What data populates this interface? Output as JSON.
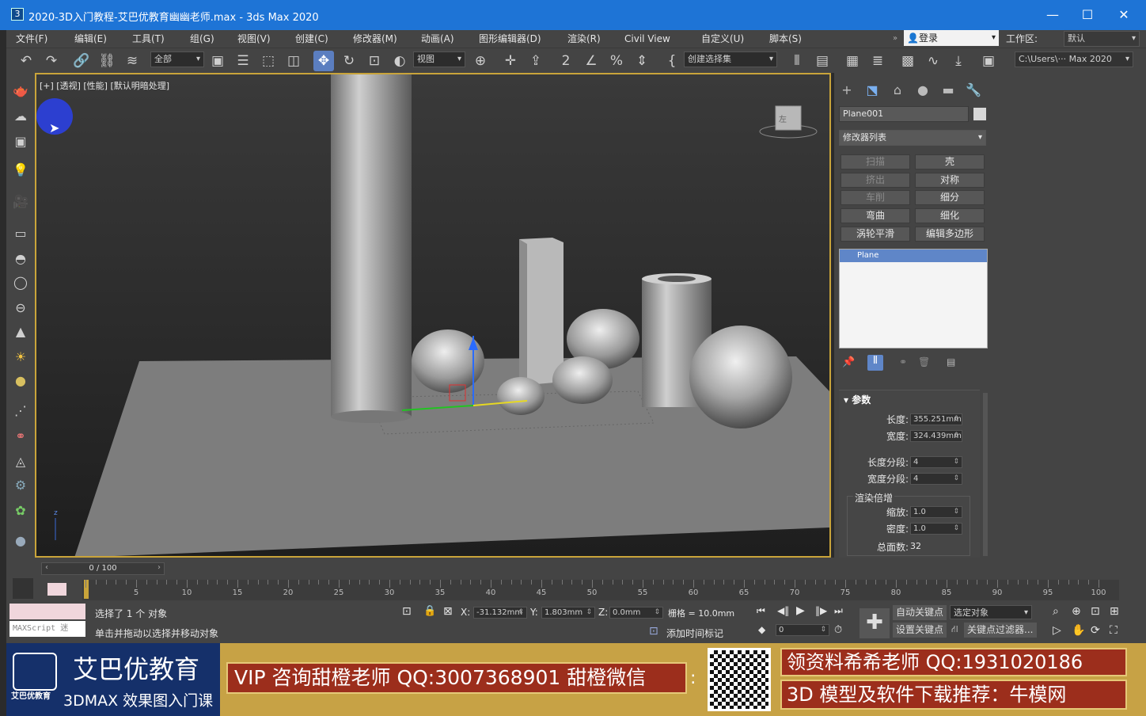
{
  "window": {
    "title": "2020-3D入门教程-艾巴优教育幽幽老师.max - 3ds Max 2020",
    "app_icon": "3",
    "minimize": "—",
    "maximize": "☐",
    "close": "✕"
  },
  "menu": [
    "文件(F)",
    "编辑(E)",
    "工具(T)",
    "组(G)",
    "视图(V)",
    "创建(C)",
    "修改器(M)",
    "动画(A)",
    "图形编辑器(D)",
    "渲染(R)",
    "Civil View",
    "自定义(U)",
    "脚本(S)"
  ],
  "user": {
    "login": "登录",
    "workspace_label": "工作区:",
    "workspace_value": "默认"
  },
  "toolbar": {
    "selection_filter": "全部",
    "ref_coord": "视图",
    "named_set": "创建选择集",
    "path": "C:\\Users\\··· Max 2020"
  },
  "viewport": {
    "label": "[+] [透视] [性能] [默认明暗处理]",
    "cube_label": "左"
  },
  "panel": {
    "object_name": "Plane001",
    "modifier_list": "修改器列表",
    "buttons_left": [
      "扫描",
      "挤出",
      "车削",
      "弯曲",
      "涡轮平滑"
    ],
    "buttons_right": [
      "壳",
      "对称",
      "细分",
      "细化",
      "编辑多边形"
    ],
    "stack_item": "Plane",
    "rollout_title": "参数",
    "length_label": "长度:",
    "length_value": "355.251mm",
    "width_label": "宽度:",
    "width_value": "324.439mm",
    "length_segs_label": "长度分段:",
    "length_segs_value": "4",
    "width_segs_label": "宽度分段:",
    "width_segs_value": "4",
    "render_mult_label": "渲染倍增",
    "scale_label": "缩放:",
    "scale_value": "1.0",
    "density_label": "密度:",
    "density_value": "1.0",
    "total_faces_label": "总面数:",
    "total_faces_value": "32"
  },
  "timeline": {
    "frame_display": "0 / 100",
    "ticks": [
      "5",
      "10",
      "15",
      "20",
      "25",
      "30",
      "35",
      "40",
      "45",
      "50",
      "55",
      "60",
      "65",
      "70",
      "75",
      "80",
      "85",
      "90",
      "95",
      "100"
    ]
  },
  "status": {
    "maxscript": "MAXScript 迷",
    "selected": "选择了 1 个 对象",
    "hint": "单击并拖动以选择并移动对象",
    "x_label": "X:",
    "x_value": "-31.132mm",
    "y_label": "Y:",
    "y_value": "1.803mm",
    "z_label": "Z:",
    "z_value": "0.0mm",
    "grid": "栅格 = 10.0mm",
    "add_time_tag": "添加时间标记",
    "auto_key": "自动关键点",
    "selected_object": "选定对象",
    "set_key": "设置关键点",
    "key_filter": "关键点过滤器...",
    "frame_value": "0"
  },
  "banner": {
    "brand": "艾巴优教育",
    "brand_small": "艾巴优教育",
    "course": "3DMAX 效果图入门课",
    "vip": "VIP 咨询甜橙老师 QQ:3007368901 甜橙微信",
    "colon": ":",
    "right_top": "领资料希希老师 QQ:1931020186",
    "right_bottom": "3D 模型及软件下载推荐：牛模网"
  }
}
